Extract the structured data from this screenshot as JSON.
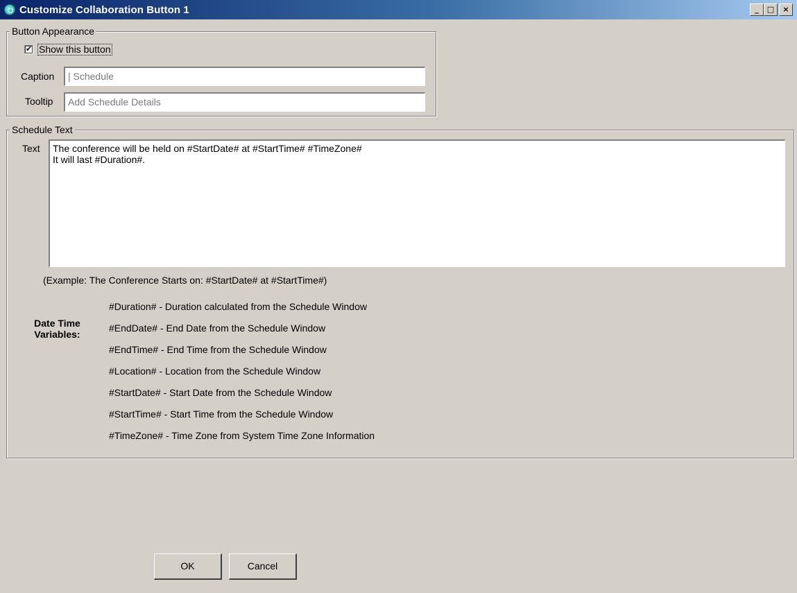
{
  "window": {
    "title": "Customize Collaboration Button 1",
    "controls": {
      "minimize": "_",
      "maximize": "□",
      "close": "×"
    }
  },
  "appearance": {
    "legend": "Button Appearance",
    "show_button_label": "Show this button",
    "show_button_checked": true,
    "checkbox_glyph": "✔",
    "caption_label": "Caption",
    "caption_value": "| Schedule",
    "tooltip_label": "Tooltip",
    "tooltip_value": "Add Schedule Details"
  },
  "schedule": {
    "legend": "Schedule Text",
    "text_label": "Text",
    "text_lines": [
      "The conference will be held on #StartDate# at #StartTime# #TimeZone#",
      "It will last #Duration#."
    ],
    "example": "(Example: The Conference Starts on: #StartDate# at #StartTime#)",
    "variables_title": "Date Time Variables:",
    "variables": [
      "#Duration# - Duration calculated from the Schedule Window",
      "#EndDate# - End Date from the Schedule Window",
      "#EndTime# - End Time from the Schedule Window",
      "#Location# - Location from the Schedule Window",
      "#StartDate# - Start Date from the Schedule Window",
      "#StartTime# - Start Time from the Schedule Window",
      "#TimeZone# - Time Zone from System Time Zone Information"
    ]
  },
  "buttons": {
    "ok": "OK",
    "cancel": "Cancel"
  }
}
